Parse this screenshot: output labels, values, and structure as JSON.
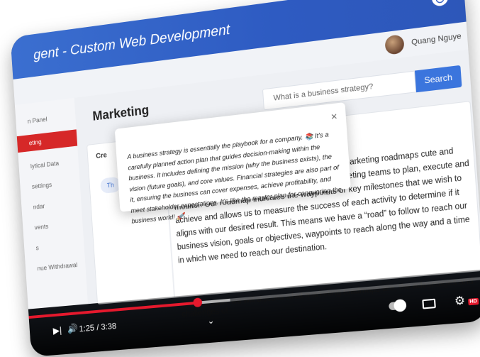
{
  "window": {
    "title": "gent - Custom Web Development"
  },
  "user": {
    "name": "Quang Nguye"
  },
  "sidebar": {
    "items": [
      {
        "label": "n Panel"
      },
      {
        "label": "eting"
      },
      {
        "label": "lytical Data"
      },
      {
        "label": "settings"
      },
      {
        "label": "ndar"
      },
      {
        "label": "vents"
      },
      {
        "label": "s"
      },
      {
        "label": "nue Withdrawal"
      }
    ],
    "active_index": 1
  },
  "main": {
    "page_title": "Marketing",
    "search": {
      "placeholder": "What is a business strategy?",
      "button_label": "Search"
    },
    "card": {
      "tab_label": "Cre",
      "tag_label": "Th",
      "lesson_text": "t of detailed information, making it  do it. We use marketing roadmaps  cute and assign them to relevant members within our marketing teams to plan, execute and monitor. Our roadmap indicates the waypoints or key milestones that we wish to achieve and allows us to measure the success of each activity to determine if it aligns with our desired result. This means we have a “road” to follow to reach our business vision, goals or objectives, waypoints to reach along the way and a time in which we need to reach our destination.",
      "lesson_text_2": "In this lesson, we will discuss what marketing roadmaps are, the advantages and challenges of"
    }
  },
  "popup": {
    "close_label": "×",
    "text": "A business strategy is essentially the playbook for a company. 📚 It's a carefully planned action plan that guides decision-making within the business. It includes defining the mission (why the business exists), the vision (future goals), and core values. Financial strategies are also part of it, ensuring the business can cover expenses, achieve profitability, and meet stakeholder expectations. It's like the master plan for conquering the business world! 🚀"
  },
  "video": {
    "time_label": "1:25 / 3:38",
    "progress": 0.387,
    "buffered": 0.46,
    "hd_label": "HD",
    "accent_color": "#e5192d"
  }
}
